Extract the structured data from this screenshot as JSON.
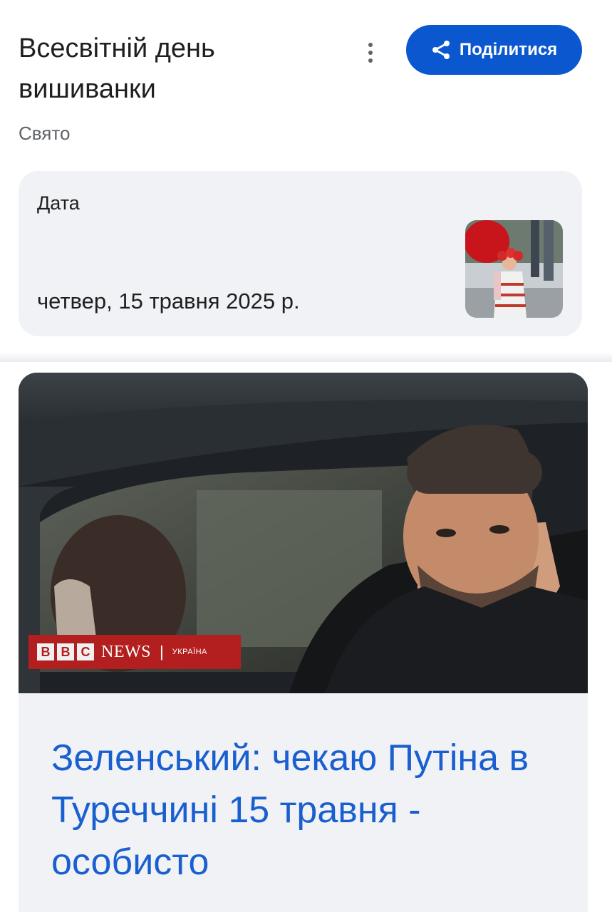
{
  "header": {
    "title": "Всесвітній день вишиванки",
    "subtitle": "Свято",
    "share_label": "Поділитися",
    "more_icon": "more-vert-icon",
    "share_icon": "share-icon"
  },
  "date_card": {
    "label": "Дата",
    "value": "четвер, 15 травня 2025 р."
  },
  "news": {
    "title": "Зеленський: чекаю Путіна в Туреччині 15 травня - особисто",
    "logo": {
      "boxes": [
        "B",
        "B",
        "C"
      ],
      "brand": "NEWS",
      "separator": "|",
      "region": "УКРАЇНА"
    }
  },
  "colors": {
    "accent": "#0b57d0",
    "link": "#1a5fd0",
    "card_bg": "#f0f2f5",
    "bbc_red": "#b31e1e"
  }
}
